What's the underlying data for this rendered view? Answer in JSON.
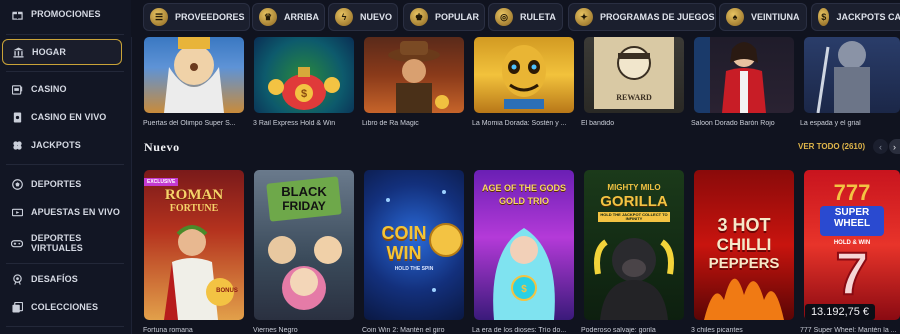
{
  "sidebar": {
    "items": [
      {
        "label": "PROMOCIONES",
        "icon": "gift-icon"
      },
      {
        "label": "HOGAR",
        "icon": "bank-icon"
      },
      {
        "label": "CASINO",
        "icon": "slot-icon"
      },
      {
        "label": "CASINO EN VIVO",
        "icon": "cards-icon"
      },
      {
        "label": "JACKPOTS",
        "icon": "diamond-icon"
      },
      {
        "label": "DEPORTES",
        "icon": "ball-icon"
      },
      {
        "label": "APUESTAS EN VIVO",
        "icon": "live-bet-icon"
      },
      {
        "label": "DEPORTES",
        "label2": "VIRTUALES",
        "icon": "gamepad-icon"
      },
      {
        "label": "DESAFÍOS",
        "icon": "trophy-icon"
      },
      {
        "label": "COLECCIONES",
        "icon": "collection-icon"
      }
    ]
  },
  "topbar": {
    "chips": [
      {
        "label": "PROVEEDORES",
        "icon": "providers-icon"
      },
      {
        "label": "ARRIBA",
        "icon": "crown-wings-icon"
      },
      {
        "label": "NUEVO",
        "icon": "lightning-icon"
      },
      {
        "label": "POPULAR",
        "icon": "crown-icon"
      },
      {
        "label": "RULETA",
        "icon": "roulette-icon"
      },
      {
        "label": "PROGRAMAS DE JUEGOS",
        "icon": "game-show-icon"
      },
      {
        "label": "VEINTIUNA",
        "icon": "blackjack-icon"
      },
      {
        "label": "JACKPOTS CA",
        "icon": "jackpot-icon"
      }
    ]
  },
  "row1": {
    "games": [
      "Puertas del Olimpo Super S...",
      "3 Rail Express Hold & Win",
      "Libro de Ra Magic",
      "La Momia Dorada: Sostén y ...",
      "El bandido",
      "Saloon Dorado Barón Rojo",
      "La espada y el grial"
    ]
  },
  "row1_art": {
    "reward": "REWARD"
  },
  "section": {
    "title": "Nuevo",
    "see_all": "VER TODO (2610)"
  },
  "row2": {
    "games": [
      "Fortuna romana",
      "Viernes Negro",
      "Coin Win 2: Mantén el giro",
      "La era de los dioses: Trío do...",
      "Poderoso salvaje: gorila",
      "3 chiles picantes",
      "777 Super Wheel: Mantén la ..."
    ],
    "art": {
      "roman_1": "ROMAN",
      "roman_2": "FORTUNE",
      "roman_badge": "BONUS",
      "exclusive": "EXCLUSIVE",
      "black": "BLACK",
      "friday": "FRIDAY",
      "coin": "COIN",
      "win": "WIN",
      "coin_sub": "HOLD THE SPIN",
      "age_1": "AGE OF THE GODS",
      "age_2": "GOLD TRIO",
      "mighty": "MIGHTY MILO",
      "gorilla": "GORILLA",
      "gorilla_sub": "HOLD THE JACKPOT COLLECT TO INFINITY",
      "hot_1": "3 HOT",
      "hot_2": "CHILLI",
      "hot_3": "PEPPERS",
      "super_1": "SUPER",
      "super_2": "WHEEL",
      "super_3": "HOLD & WIN",
      "jackpot_price": "13.192,75 €"
    }
  }
}
